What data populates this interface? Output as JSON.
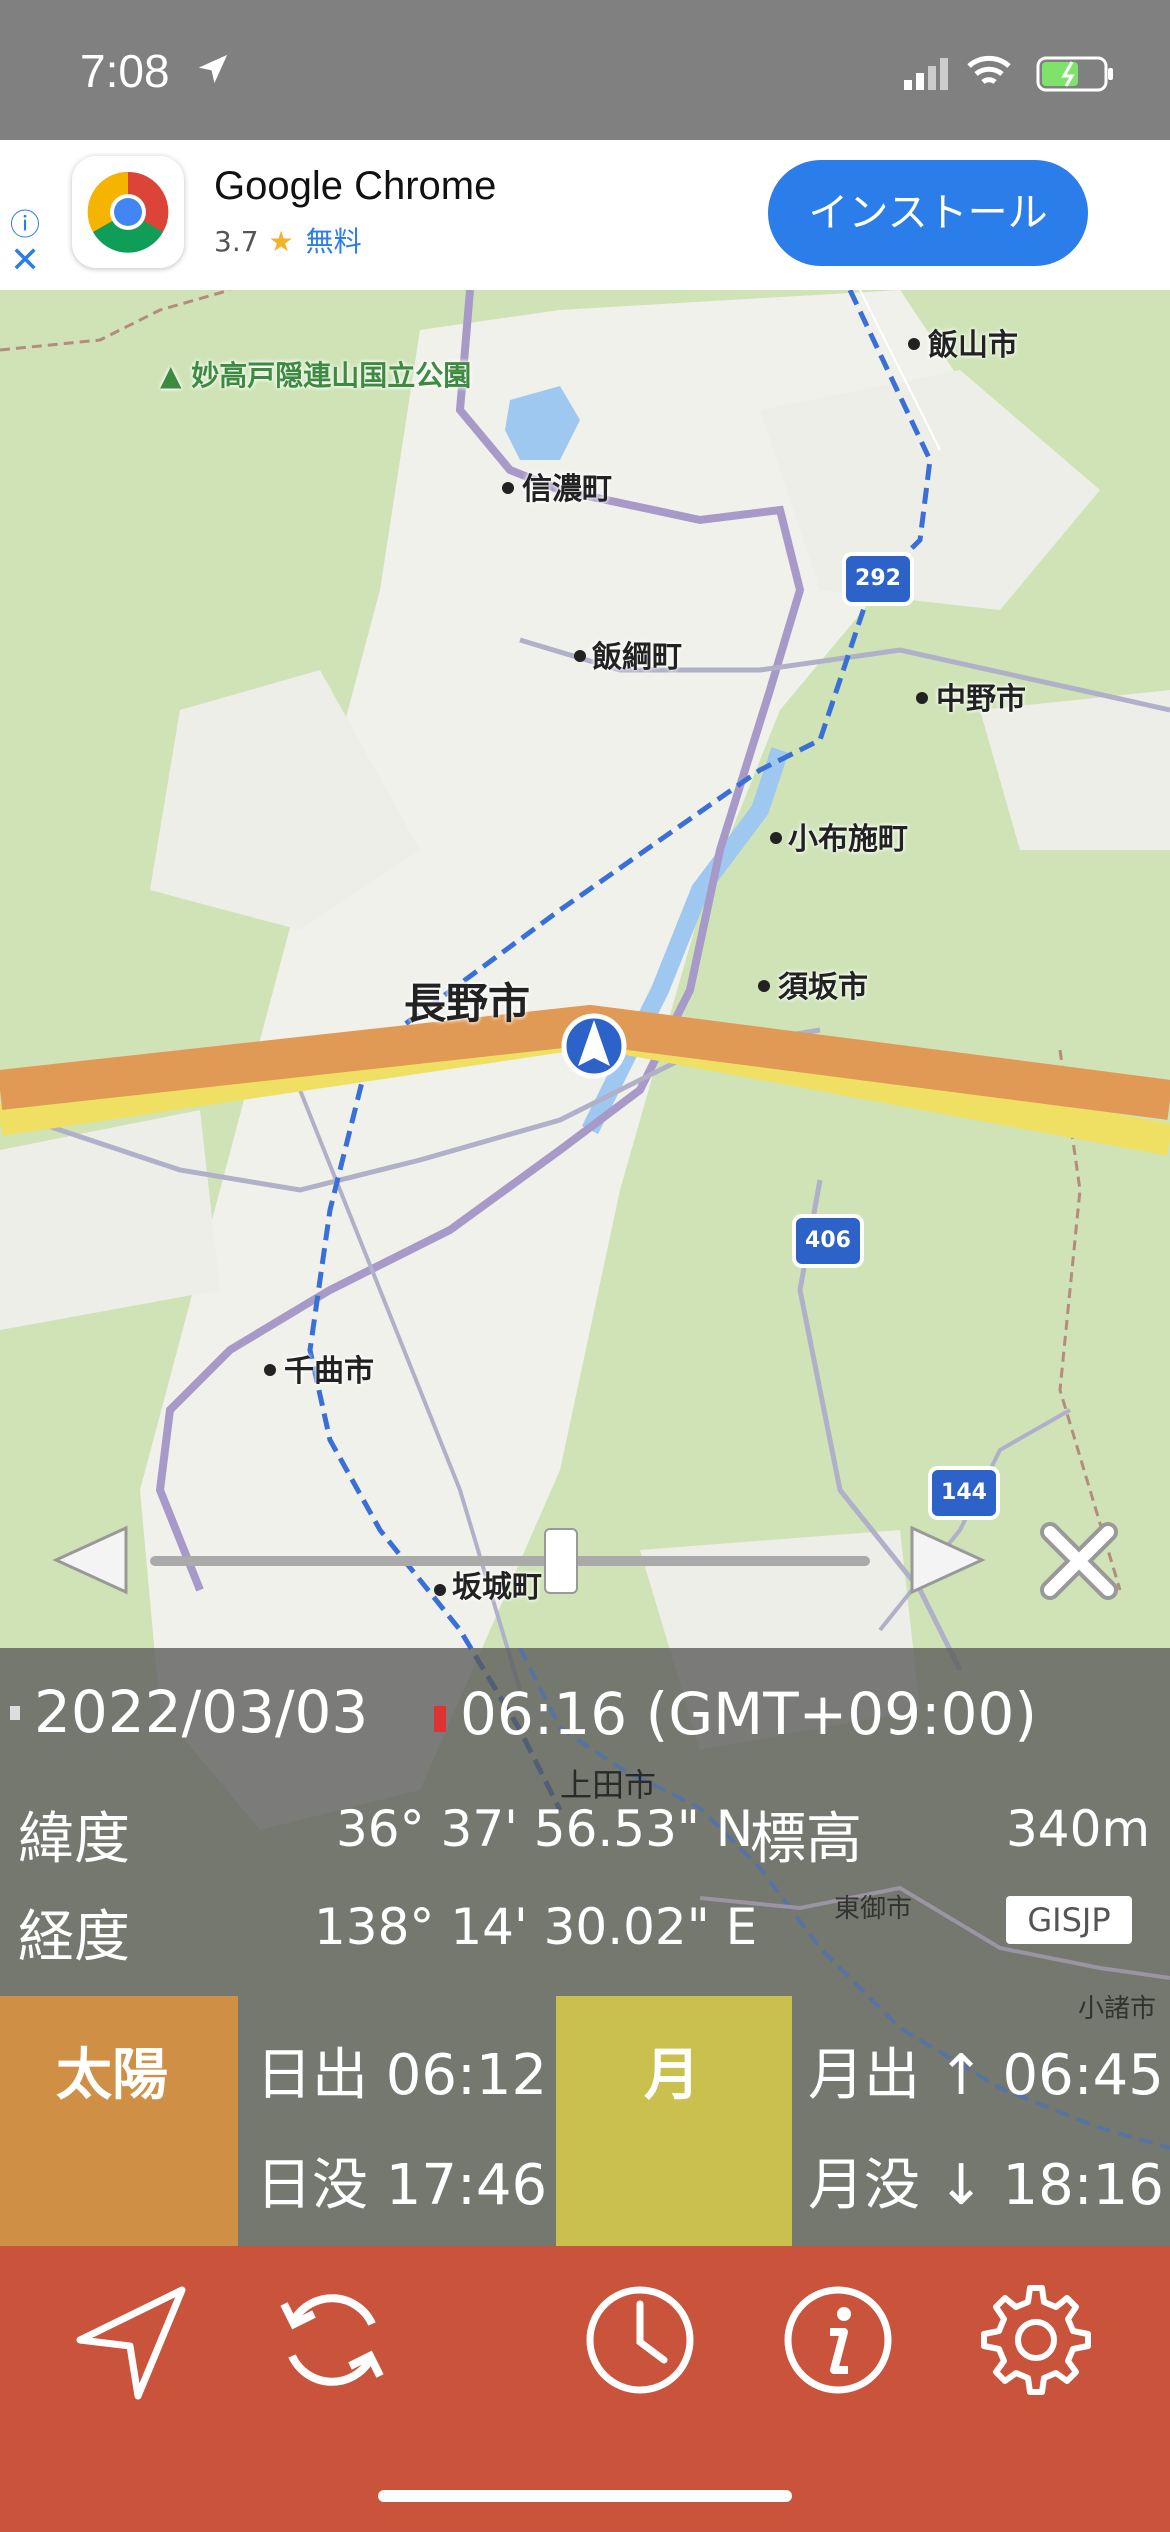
{
  "status_bar": {
    "time": "7:08"
  },
  "ad_banner": {
    "app_name": "Google Chrome",
    "rating": "3.7",
    "star": "★",
    "price": "無料",
    "install_label": "インストール",
    "info_icon": "ⓘ",
    "close_icon": "✕"
  },
  "map": {
    "labels": {
      "park": "妙高戸隠連山国立公園",
      "iiyama": "飯山市",
      "shinano": "信濃町",
      "iizuna": "飯綱町",
      "nakano": "中野市",
      "obuse": "小布施町",
      "suzaka": "須坂市",
      "nagano": "長野市",
      "chikuma": "千曲市",
      "sakaki": "坂城町",
      "ueda": "上田市",
      "tomi": "東御市",
      "komoro": "小諸市"
    },
    "routes": {
      "r292": "292",
      "r406": "406",
      "r144": "144"
    },
    "colors": {
      "sunrise_line": "#e09a55",
      "moon_line": "#efe063",
      "rail": "#3a6fd8",
      "road": "#9b86c7"
    }
  },
  "timeline": {
    "prev_icon": "triangle-left",
    "next_icon": "triangle-right",
    "close_icon": "x",
    "position": 0.57
  },
  "info_panel": {
    "date": "2022/03/03",
    "time": "06:16 (GMT+09:00)",
    "lat_label": "緯度",
    "lat_value": "36° 37' 56.53\" N",
    "elev_label": "標高",
    "elev_value": "340m",
    "lon_label": "経度",
    "lon_value": "138° 14' 30.02\" E",
    "source_badge": "GISJP",
    "sun_label": "太陽",
    "sunrise": "日出 06:12",
    "sunset": "日没 17:46",
    "moon_label": "月",
    "moonrise": "月出 ↑ 06:45",
    "moonset": "月没 ↓ 18:16"
  },
  "tab_bar": {
    "icons": [
      "location-arrow-icon",
      "refresh-icon",
      "clock-icon",
      "info-icon",
      "gear-icon"
    ],
    "color": "#c9533b"
  }
}
